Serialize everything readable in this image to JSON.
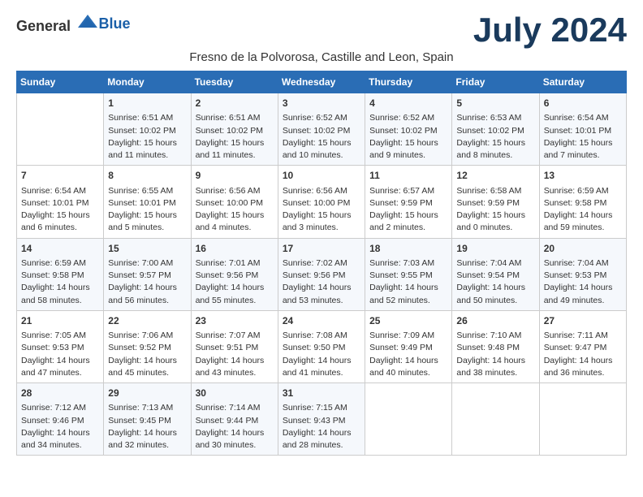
{
  "header": {
    "title": "July 2024",
    "subtitle": "Fresno de la Polvorosa, Castille and Leon, Spain",
    "logo_general": "General",
    "logo_blue": "Blue"
  },
  "weekdays": [
    "Sunday",
    "Monday",
    "Tuesday",
    "Wednesday",
    "Thursday",
    "Friday",
    "Saturday"
  ],
  "weeks": [
    [
      {
        "day": "",
        "info": ""
      },
      {
        "day": "1",
        "info": "Sunrise: 6:51 AM\nSunset: 10:02 PM\nDaylight: 15 hours\nand 11 minutes."
      },
      {
        "day": "2",
        "info": "Sunrise: 6:51 AM\nSunset: 10:02 PM\nDaylight: 15 hours\nand 11 minutes."
      },
      {
        "day": "3",
        "info": "Sunrise: 6:52 AM\nSunset: 10:02 PM\nDaylight: 15 hours\nand 10 minutes."
      },
      {
        "day": "4",
        "info": "Sunrise: 6:52 AM\nSunset: 10:02 PM\nDaylight: 15 hours\nand 9 minutes."
      },
      {
        "day": "5",
        "info": "Sunrise: 6:53 AM\nSunset: 10:02 PM\nDaylight: 15 hours\nand 8 minutes."
      },
      {
        "day": "6",
        "info": "Sunrise: 6:54 AM\nSunset: 10:01 PM\nDaylight: 15 hours\nand 7 minutes."
      }
    ],
    [
      {
        "day": "7",
        "info": "Sunrise: 6:54 AM\nSunset: 10:01 PM\nDaylight: 15 hours\nand 6 minutes."
      },
      {
        "day": "8",
        "info": "Sunrise: 6:55 AM\nSunset: 10:01 PM\nDaylight: 15 hours\nand 5 minutes."
      },
      {
        "day": "9",
        "info": "Sunrise: 6:56 AM\nSunset: 10:00 PM\nDaylight: 15 hours\nand 4 minutes."
      },
      {
        "day": "10",
        "info": "Sunrise: 6:56 AM\nSunset: 10:00 PM\nDaylight: 15 hours\nand 3 minutes."
      },
      {
        "day": "11",
        "info": "Sunrise: 6:57 AM\nSunset: 9:59 PM\nDaylight: 15 hours\nand 2 minutes."
      },
      {
        "day": "12",
        "info": "Sunrise: 6:58 AM\nSunset: 9:59 PM\nDaylight: 15 hours\nand 0 minutes."
      },
      {
        "day": "13",
        "info": "Sunrise: 6:59 AM\nSunset: 9:58 PM\nDaylight: 14 hours\nand 59 minutes."
      }
    ],
    [
      {
        "day": "14",
        "info": "Sunrise: 6:59 AM\nSunset: 9:58 PM\nDaylight: 14 hours\nand 58 minutes."
      },
      {
        "day": "15",
        "info": "Sunrise: 7:00 AM\nSunset: 9:57 PM\nDaylight: 14 hours\nand 56 minutes."
      },
      {
        "day": "16",
        "info": "Sunrise: 7:01 AM\nSunset: 9:56 PM\nDaylight: 14 hours\nand 55 minutes."
      },
      {
        "day": "17",
        "info": "Sunrise: 7:02 AM\nSunset: 9:56 PM\nDaylight: 14 hours\nand 53 minutes."
      },
      {
        "day": "18",
        "info": "Sunrise: 7:03 AM\nSunset: 9:55 PM\nDaylight: 14 hours\nand 52 minutes."
      },
      {
        "day": "19",
        "info": "Sunrise: 7:04 AM\nSunset: 9:54 PM\nDaylight: 14 hours\nand 50 minutes."
      },
      {
        "day": "20",
        "info": "Sunrise: 7:04 AM\nSunset: 9:53 PM\nDaylight: 14 hours\nand 49 minutes."
      }
    ],
    [
      {
        "day": "21",
        "info": "Sunrise: 7:05 AM\nSunset: 9:53 PM\nDaylight: 14 hours\nand 47 minutes."
      },
      {
        "day": "22",
        "info": "Sunrise: 7:06 AM\nSunset: 9:52 PM\nDaylight: 14 hours\nand 45 minutes."
      },
      {
        "day": "23",
        "info": "Sunrise: 7:07 AM\nSunset: 9:51 PM\nDaylight: 14 hours\nand 43 minutes."
      },
      {
        "day": "24",
        "info": "Sunrise: 7:08 AM\nSunset: 9:50 PM\nDaylight: 14 hours\nand 41 minutes."
      },
      {
        "day": "25",
        "info": "Sunrise: 7:09 AM\nSunset: 9:49 PM\nDaylight: 14 hours\nand 40 minutes."
      },
      {
        "day": "26",
        "info": "Sunrise: 7:10 AM\nSunset: 9:48 PM\nDaylight: 14 hours\nand 38 minutes."
      },
      {
        "day": "27",
        "info": "Sunrise: 7:11 AM\nSunset: 9:47 PM\nDaylight: 14 hours\nand 36 minutes."
      }
    ],
    [
      {
        "day": "28",
        "info": "Sunrise: 7:12 AM\nSunset: 9:46 PM\nDaylight: 14 hours\nand 34 minutes."
      },
      {
        "day": "29",
        "info": "Sunrise: 7:13 AM\nSunset: 9:45 PM\nDaylight: 14 hours\nand 32 minutes."
      },
      {
        "day": "30",
        "info": "Sunrise: 7:14 AM\nSunset: 9:44 PM\nDaylight: 14 hours\nand 30 minutes."
      },
      {
        "day": "31",
        "info": "Sunrise: 7:15 AM\nSunset: 9:43 PM\nDaylight: 14 hours\nand 28 minutes."
      },
      {
        "day": "",
        "info": ""
      },
      {
        "day": "",
        "info": ""
      },
      {
        "day": "",
        "info": ""
      }
    ]
  ]
}
